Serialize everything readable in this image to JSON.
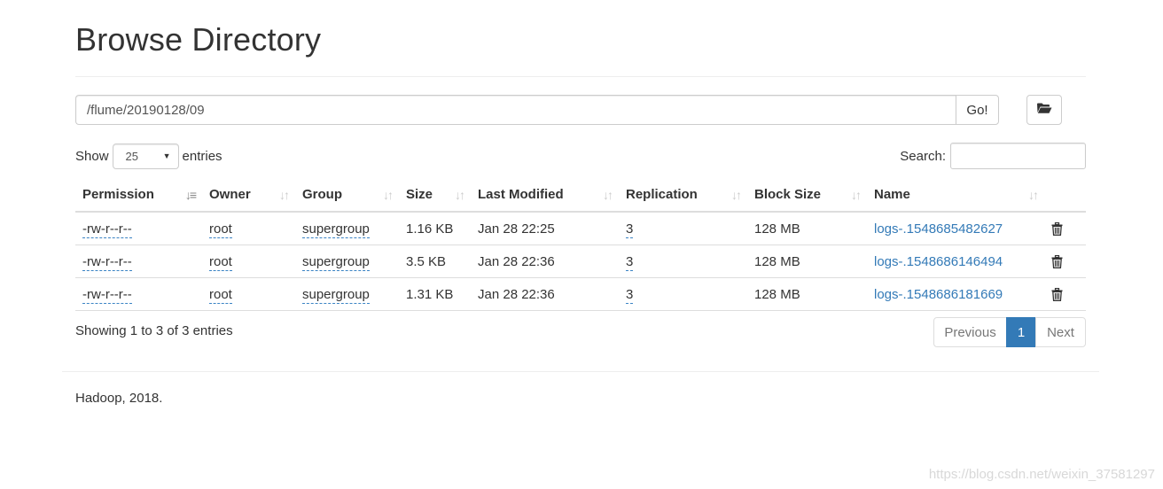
{
  "page": {
    "title": "Browse Directory"
  },
  "path_bar": {
    "value": "/flume/20190128/09",
    "go_label": "Go!",
    "folder_icon": "folder-open-icon"
  },
  "length_control": {
    "prefix": "Show",
    "selected": "25",
    "suffix": "entries"
  },
  "search": {
    "label": "Search:",
    "value": ""
  },
  "table": {
    "columns": [
      "Permission",
      "Owner",
      "Group",
      "Size",
      "Last Modified",
      "Replication",
      "Block Size",
      "Name"
    ],
    "sorted_column": "Permission",
    "sort_direction": "asc",
    "rows": [
      {
        "permission": "-rw-r--r--",
        "owner": "root",
        "group": "supergroup",
        "size": "1.16 KB",
        "last_modified": "Jan 28 22:25",
        "replication": "3",
        "block_size": "128 MB",
        "name": "logs-.1548685482627"
      },
      {
        "permission": "-rw-r--r--",
        "owner": "root",
        "group": "supergroup",
        "size": "3.5 KB",
        "last_modified": "Jan 28 22:36",
        "replication": "3",
        "block_size": "128 MB",
        "name": "logs-.1548686146494"
      },
      {
        "permission": "-rw-r--r--",
        "owner": "root",
        "group": "supergroup",
        "size": "1.31 KB",
        "last_modified": "Jan 28 22:36",
        "replication": "3",
        "block_size": "128 MB",
        "name": "logs-.1548686181669"
      }
    ]
  },
  "info": {
    "text": "Showing 1 to 3 of 3 entries"
  },
  "pagination": {
    "previous": "Previous",
    "current": "1",
    "next": "Next"
  },
  "footer": {
    "text": "Hadoop, 2018."
  },
  "watermark": {
    "text": "https://blog.csdn.net/weixin_37581297"
  },
  "colors": {
    "link": "#337ab7",
    "active_page": "#337ab7",
    "border": "#dddddd"
  }
}
